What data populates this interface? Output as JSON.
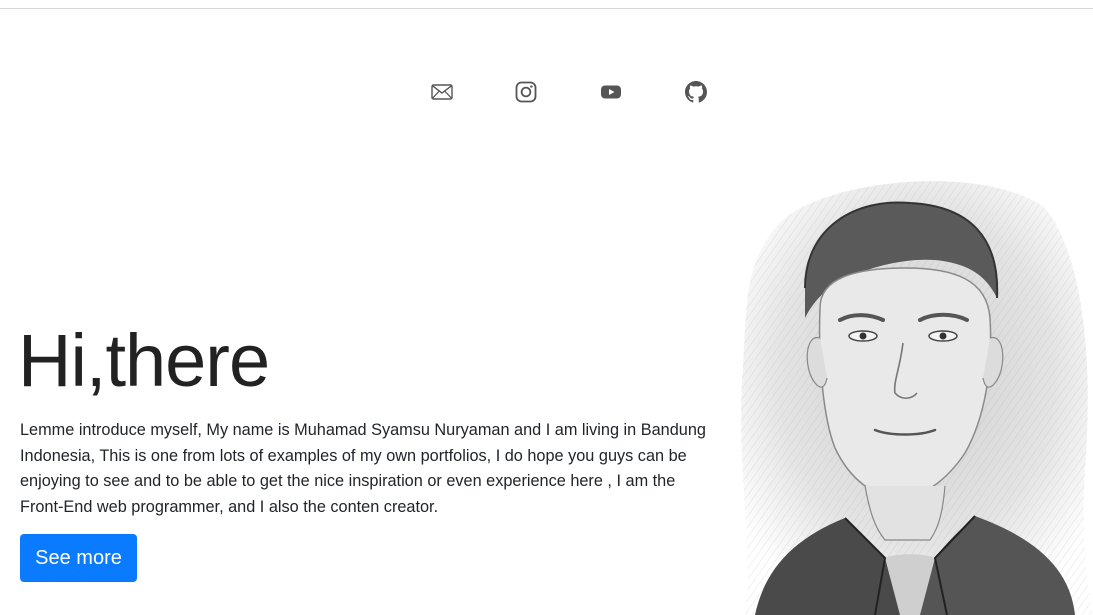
{
  "social": {
    "links": [
      {
        "icon": "mail-icon",
        "label": "Email"
      },
      {
        "icon": "instagram-icon",
        "label": "Instagram"
      },
      {
        "icon": "youtube-icon",
        "label": "YouTube"
      },
      {
        "icon": "github-icon",
        "label": "GitHub"
      }
    ]
  },
  "hero": {
    "title": "Hi,there",
    "intro": "Lemme introduce myself, My name is Muhamad Syamsu Nuryaman and I am living in Bandung Indonesia, This is one from lots of examples of my own portfolios, I do hope you guys can be enjoying to see and to be able to get the nice inspiration or even experience here , I am the Front-End web programmer, and I also the conten creator.",
    "button_label": "See more"
  },
  "colors": {
    "accent": "#0a7bff",
    "icon": "#555555",
    "text": "#212529"
  }
}
